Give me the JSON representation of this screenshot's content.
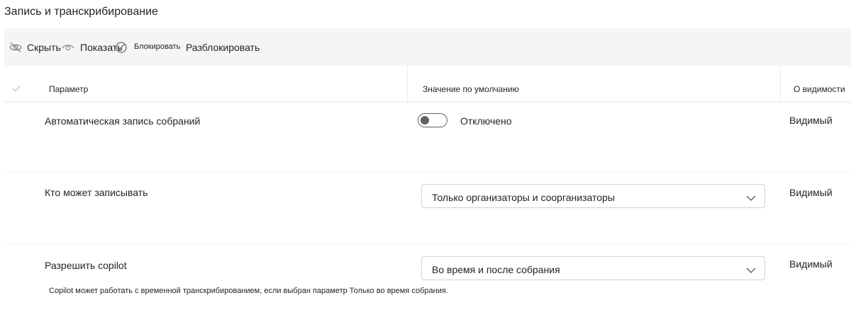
{
  "page": {
    "title": "Запись и транскрибирование"
  },
  "toolbar": {
    "hide_label": "Скрыть",
    "hide_icon": "eye-off-icon",
    "show_label": "Показать",
    "show_icon": "eye-icon",
    "block_label": "Блокировать",
    "block_icon": "block-icon",
    "unblock_label": "Разблокировать"
  },
  "table": {
    "headers": {
      "parameter": "Параметр",
      "default_value": "Значение по умолчанию",
      "visibility": "О видимости"
    },
    "rows": [
      {
        "name": "Автоматическая запись собраний",
        "control": "toggle",
        "toggle_on": false,
        "value": "Отключено",
        "visibility": "Видимый"
      },
      {
        "name": "Кто может записывать",
        "control": "dropdown",
        "value": "Только организаторы и соорганизаторы",
        "visibility": "Видимый"
      },
      {
        "name": "Разрешить copilot",
        "control": "dropdown",
        "value": "Во время и после собрания",
        "visibility": "Видимый",
        "note": "Copilot может работать с временной транскрибированием, если выбран параметр Только во время собрания."
      }
    ]
  },
  "colors": {
    "toolbar_bg": "#f5f5f5",
    "text": "#242424",
    "icon": "#707070",
    "border": "#d1d1d1"
  }
}
